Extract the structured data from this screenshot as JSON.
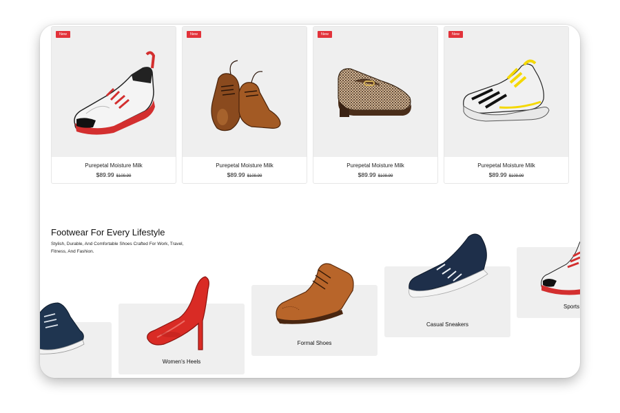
{
  "products": [
    {
      "badge": "New",
      "name": "Purepetal Moisture Milk",
      "price": "$89.99",
      "old_price": "$109.99",
      "image_icon": "sneaker-red-white-icon"
    },
    {
      "badge": "New",
      "name": "Purepetal Moisture Milk",
      "price": "$89.99",
      "old_price": "$109.99",
      "image_icon": "brown-oxford-icon"
    },
    {
      "badge": "New",
      "name": "Purepetal Moisture Milk",
      "price": "$89.99",
      "old_price": "$109.99",
      "image_icon": "houndstooth-loafer-icon"
    },
    {
      "badge": "New",
      "name": "Purepetal Moisture Milk",
      "price": "$89.99",
      "old_price": "$109.99",
      "image_icon": "yellow-running-shoe-icon"
    }
  ],
  "lifestyle": {
    "title": "Footwear For Every Lifestyle",
    "subtitle": "Stylish, Durable, And Comfortable Shoes Crafted For Work, Travel, Fitness, And Fashion."
  },
  "categories": [
    {
      "label": "",
      "image_icon": "navy-sneaker-icon"
    },
    {
      "label": "Women's Heels",
      "image_icon": "red-heel-icon"
    },
    {
      "label": "Formal Shoes",
      "image_icon": "brogue-icon"
    },
    {
      "label": "Casual Sneakers",
      "image_icon": "navy-casual-sneaker-icon"
    },
    {
      "label": "Sports",
      "image_icon": "sport-sneaker-icon"
    }
  ],
  "colors": {
    "badge": "#e2323a",
    "card_bg": "#efefef"
  }
}
